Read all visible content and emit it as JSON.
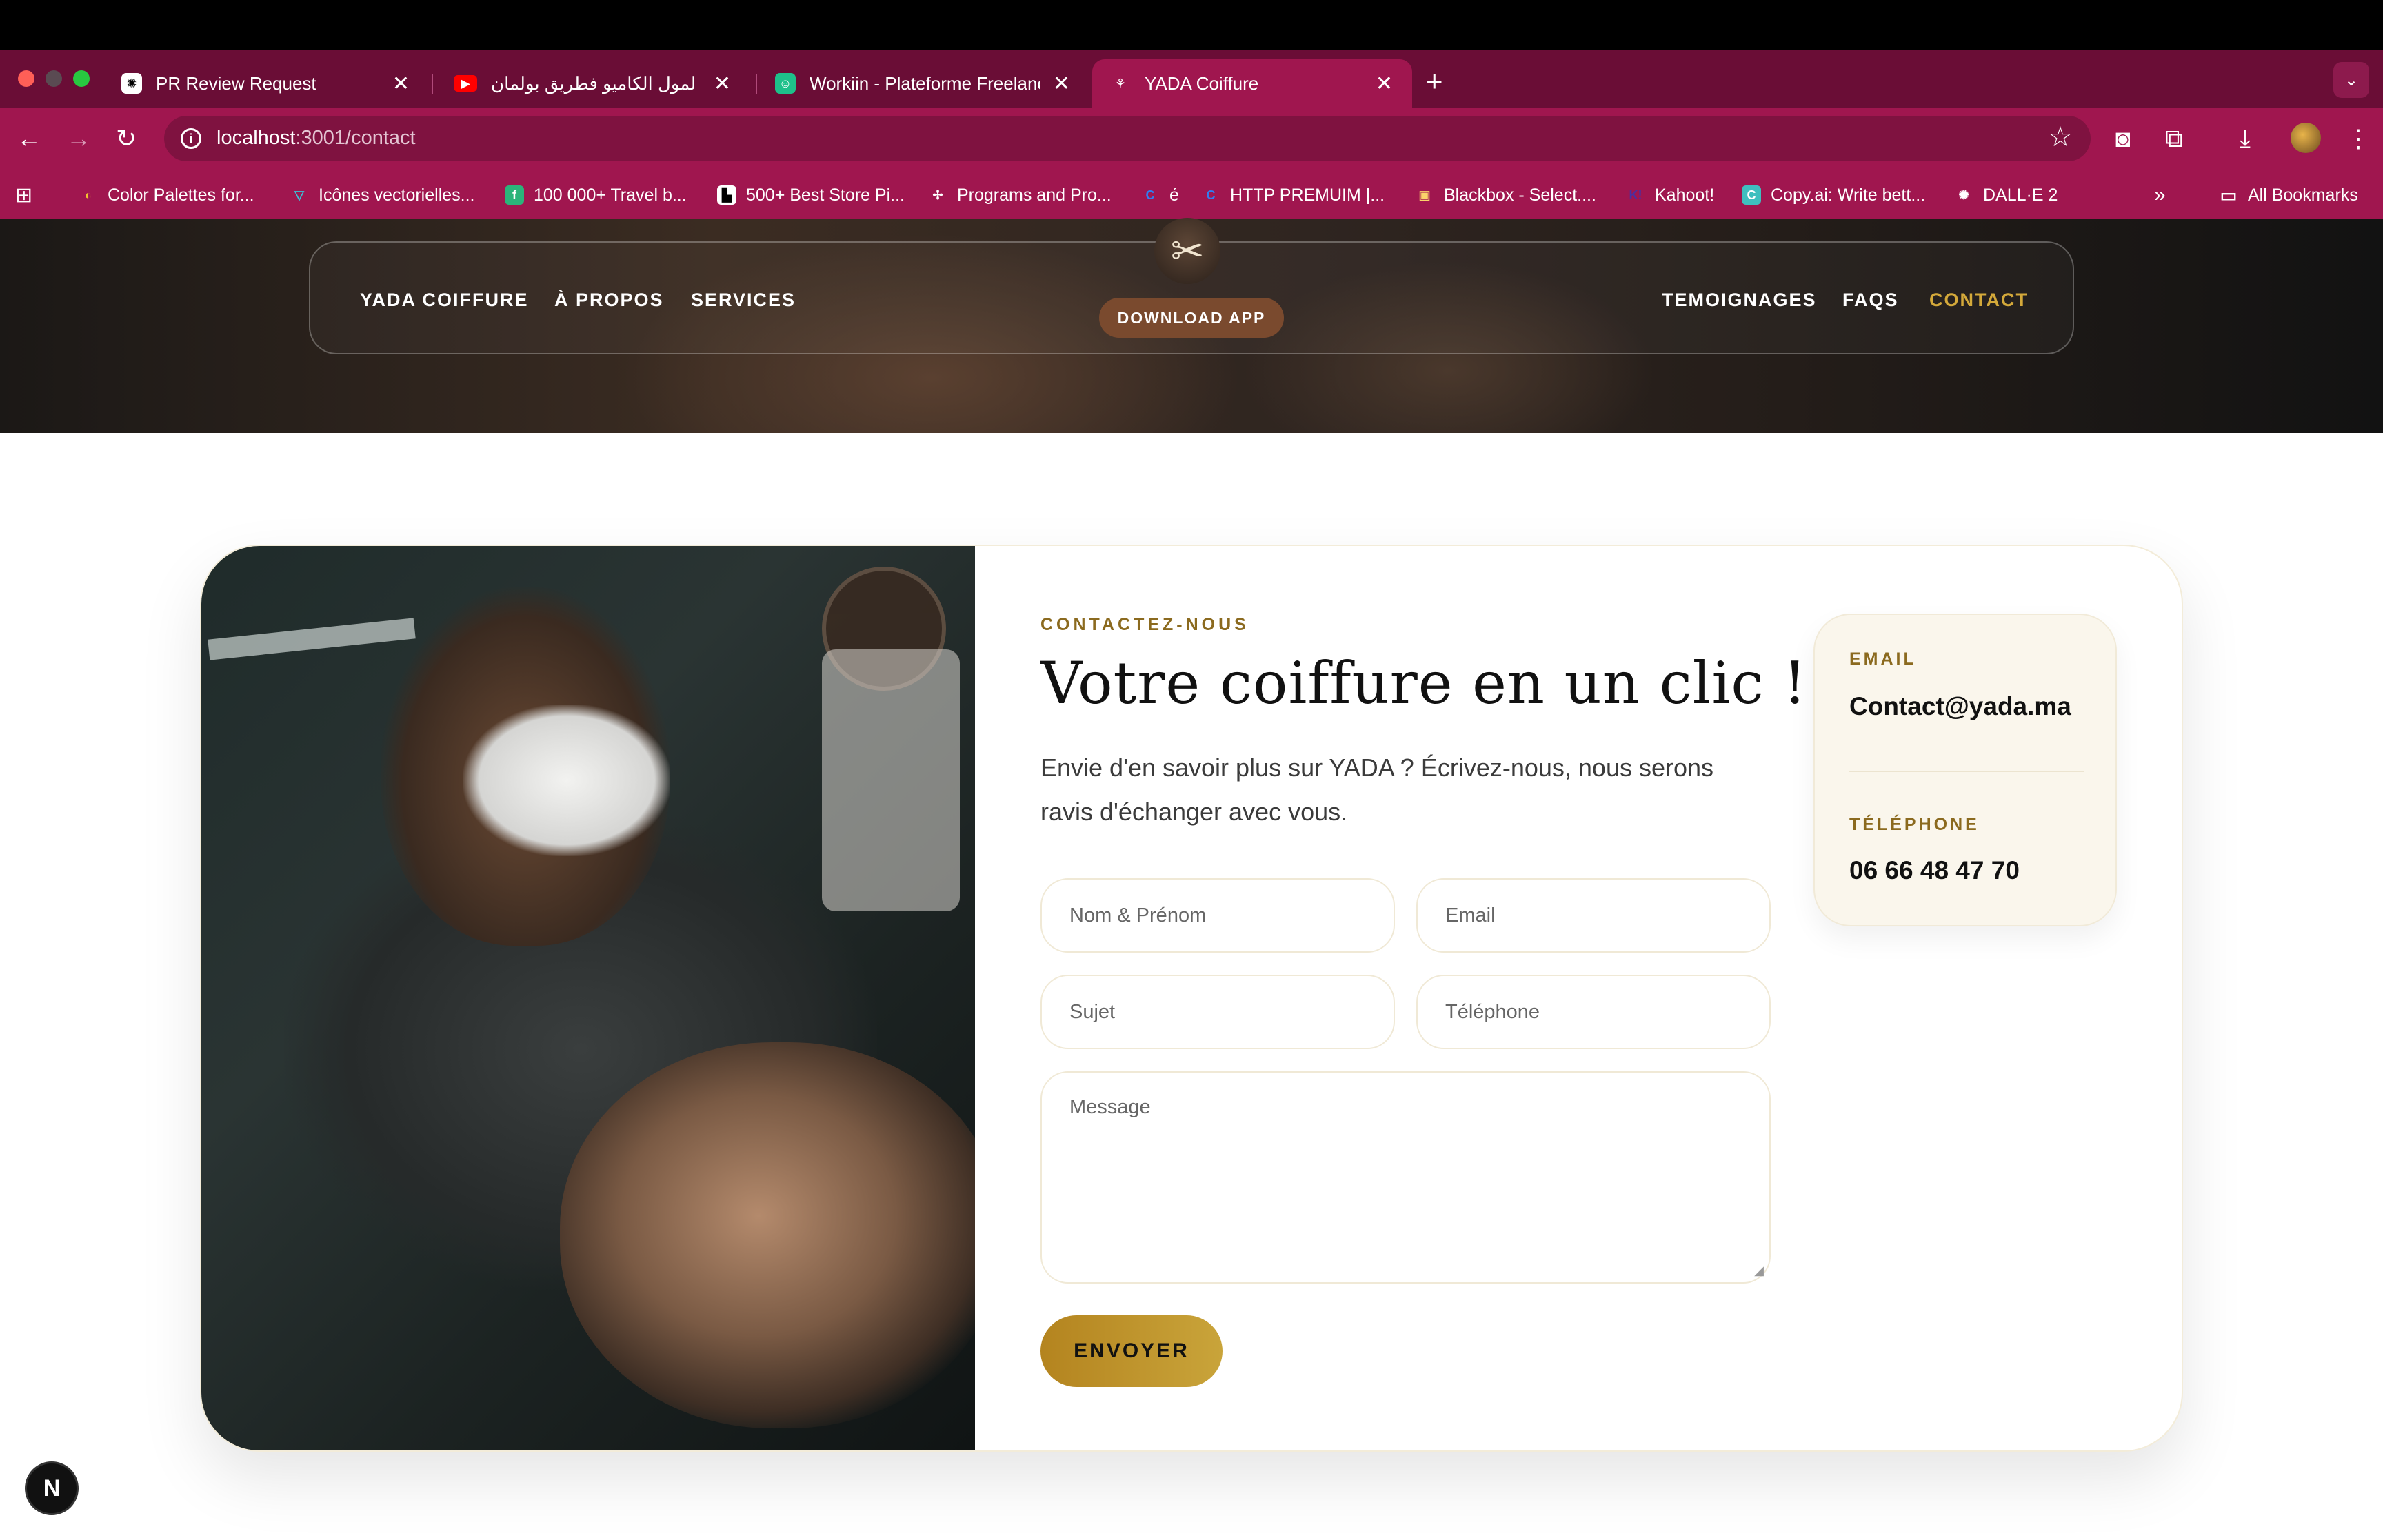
{
  "browser": {
    "tabs": [
      {
        "title": "PR Review Request",
        "icon": "openai-icon",
        "active": false
      },
      {
        "title": "لي وقع لمول الكاميو فطريق بولمان",
        "icon": "youtube-icon",
        "active": false
      },
      {
        "title": "Workiin - Plateforme Freelance",
        "icon": "workiin-icon",
        "active": false
      },
      {
        "title": "YADA Coiffure",
        "icon": "yada-icon",
        "active": true
      }
    ],
    "url_host": "localhost",
    "url_rest": ":3001/contact",
    "bookmarks": [
      {
        "label": "Color Palettes for..."
      },
      {
        "label": "Icônes vectorielles..."
      },
      {
        "label": "100 000+ Travel b..."
      },
      {
        "label": "500+ Best Store Pi..."
      },
      {
        "label": "Programs and Pro..."
      },
      {
        "label": "é"
      },
      {
        "label": "HTTP PREMUIM |..."
      },
      {
        "label": "Blackbox - Select...."
      },
      {
        "label": "Kahoot!"
      },
      {
        "label": "Copy.ai: Write bett..."
      },
      {
        "label": "DALL·E 2"
      }
    ],
    "all_bookmarks": "All Bookmarks",
    "theme_color": "#a0164f"
  },
  "site": {
    "nav": {
      "left": [
        "YADA COIFFURE",
        "À PROPOS",
        "SERVICES"
      ],
      "right": [
        "TEMOIGNAGES",
        "FAQS",
        "CONTACT"
      ],
      "active": "CONTACT",
      "download_label": "DOWNLOAD APP",
      "logo_icon": "scissors-icon"
    },
    "contact": {
      "eyebrow": "CONTACTEZ-NOUS",
      "title": "Votre coiffure en un clic !",
      "lead": "Envie d'en savoir plus sur YADA ? Écrivez-nous, nous serons ravis d'échanger avec vous.",
      "placeholders": {
        "name": "Nom & Prénom",
        "email": "Email",
        "subject": "Sujet",
        "phone": "Téléphone",
        "message": "Message"
      },
      "submit_label": "ENVOYER",
      "info": {
        "email_label": "EMAIL",
        "email_value": "Contact@yada.ma",
        "phone_label": "TÉLÉPHONE",
        "phone_value": "06 66 48 47 70"
      },
      "accent_color": "#b4841f"
    },
    "badge": "N"
  }
}
